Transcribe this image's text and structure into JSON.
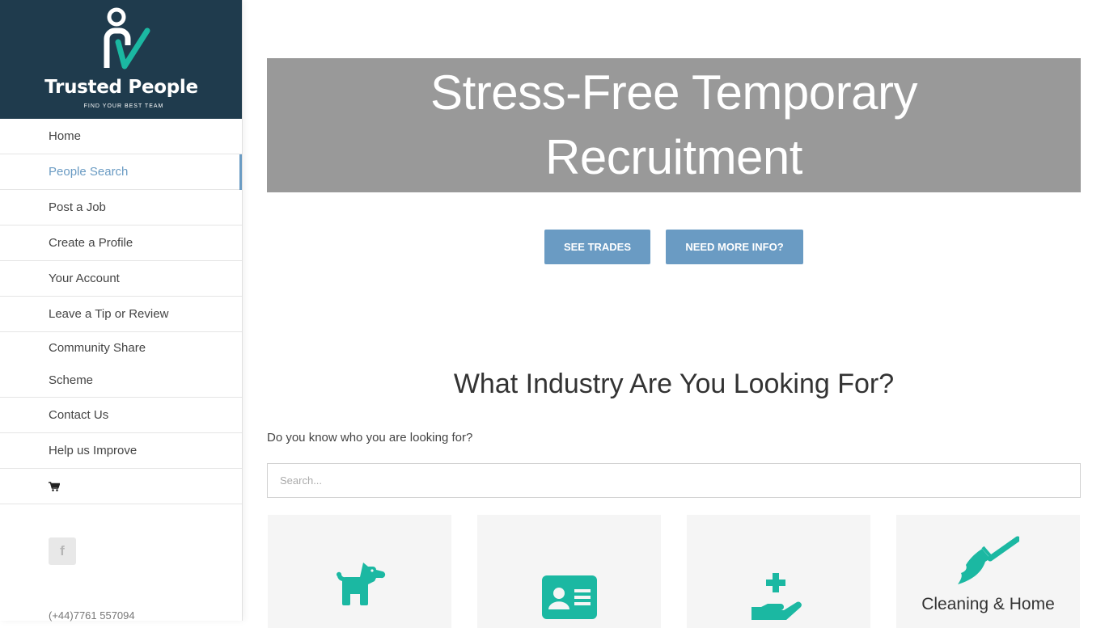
{
  "brand": {
    "name": "Trusted People",
    "tagline": "FIND YOUR BEST TEAM",
    "colors": {
      "header_bg": "#1f3b4d",
      "accent": "#6a9bc3",
      "icon": "#1bb8a2"
    }
  },
  "sidebar": {
    "items": [
      {
        "label": "Home",
        "active": false
      },
      {
        "label": "People Search",
        "active": true
      },
      {
        "label": "Post a Job",
        "active": false
      },
      {
        "label": "Create a Profile",
        "active": false
      },
      {
        "label": "Your Account",
        "active": false
      },
      {
        "label": "Leave a Tip or Review",
        "active": false
      },
      {
        "label": "Community Share Scheme",
        "active": false
      },
      {
        "label": "Contact Us",
        "active": false
      },
      {
        "label": "Help us Improve",
        "active": false
      }
    ],
    "cart_icon": "shopping-cart-icon",
    "social": {
      "facebook_glyph": "f"
    },
    "phone": "(+44)7761 557094"
  },
  "hero": {
    "title_line1": "Stress-Free Temporary",
    "title_line2": "Recruitment"
  },
  "buttons": {
    "see_trades": "SEE TRADES",
    "more_info": "NEED MORE INFO?"
  },
  "industry": {
    "heading": "What Industry Are You Looking For?",
    "question": "Do you know who you are looking for?",
    "search_placeholder": "Search...",
    "cards": [
      {
        "icon": "dog-icon",
        "label": ""
      },
      {
        "icon": "id-card-icon",
        "label": ""
      },
      {
        "icon": "hand-medical-icon",
        "label": ""
      },
      {
        "icon": "broom-icon",
        "label": "Cleaning & Home"
      }
    ]
  }
}
